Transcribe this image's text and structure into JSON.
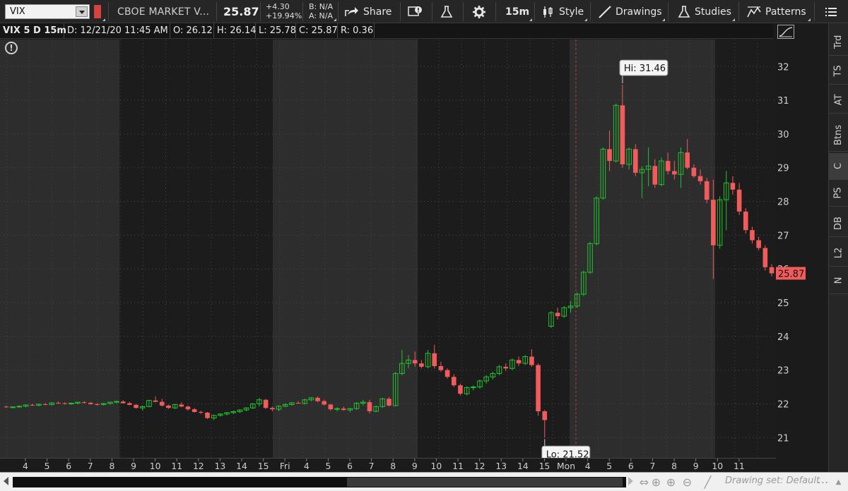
{
  "toolbar": {
    "symbol": "VIX",
    "description": "CBOE MARKET V...",
    "last_price": "25.87",
    "net_change": "+4.30",
    "pct_change": "+19.94%",
    "bid": "B: N/A",
    "ask": "A: N/A",
    "share_label": "Share",
    "timeframe": "15m",
    "style_label": "Style",
    "drawings_label": "Drawings",
    "studies_label": "Studies",
    "patterns_label": "Patterns"
  },
  "infobar": {
    "title": "VIX 5 D 15m",
    "date": "D: 12/21/20 11:45 AM",
    "open": "O: 26.12",
    "high": "H: 26.14",
    "low": "L: 25.78",
    "close": "C: 25.87",
    "range": "R: 0.36"
  },
  "side_tabs": [
    "Trd",
    "TS",
    "AT",
    "Btns",
    "C",
    "PS",
    "DB",
    "L2",
    "N"
  ],
  "active_side_tab": "C",
  "bottom": {
    "drawing_set": "Drawing set: Default"
  },
  "chart_data": {
    "type": "candlestick",
    "symbol": "VIX",
    "ylim": [
      20.4,
      32.8
    ],
    "y_ticks": [
      21,
      22,
      23,
      24,
      25,
      26,
      27,
      28,
      29,
      30,
      31,
      32
    ],
    "x_tick_labels": [
      "4",
      "5",
      "6",
      "7",
      "8",
      "9",
      "10",
      "11",
      "12",
      "13",
      "14",
      "15",
      "Fri",
      "4",
      "5",
      "6",
      "7",
      "8",
      "9",
      "10",
      "11",
      "12",
      "13",
      "14",
      "15",
      "Mon",
      "4",
      "5",
      "6",
      "7",
      "8",
      "9",
      "10",
      "11"
    ],
    "last_price_label": "25.87",
    "hi_label": "Hi: 31.46",
    "lo_label": "Lo: 21.52",
    "colors": {
      "up": "#22c22e",
      "down": "#f25b5b",
      "session_light": "#2d2d2d",
      "session_dark": "#1c1c1c"
    },
    "candles": [
      [
        21.92,
        21.95,
        21.88,
        21.9
      ],
      [
        21.9,
        21.93,
        21.87,
        21.91
      ],
      [
        21.91,
        21.95,
        21.88,
        21.93
      ],
      [
        21.93,
        21.98,
        21.9,
        21.97
      ],
      [
        21.97,
        22.0,
        21.94,
        21.96
      ],
      [
        21.96,
        22.01,
        21.93,
        21.99
      ],
      [
        21.99,
        22.03,
        21.96,
        21.98
      ],
      [
        21.98,
        22.05,
        21.95,
        22.03
      ],
      [
        22.03,
        22.07,
        22.0,
        22.02
      ],
      [
        22.02,
        22.05,
        21.98,
        22.0
      ],
      [
        22.0,
        22.04,
        21.97,
        22.02
      ],
      [
        22.02,
        22.06,
        21.99,
        22.05
      ],
      [
        22.05,
        22.08,
        22.01,
        22.03
      ],
      [
        22.03,
        22.06,
        21.98,
        21.99
      ],
      [
        21.99,
        22.02,
        21.95,
        21.98
      ],
      [
        21.98,
        22.03,
        21.95,
        22.01
      ],
      [
        22.01,
        22.06,
        21.98,
        22.05
      ],
      [
        22.05,
        22.1,
        22.02,
        22.07
      ],
      [
        22.07,
        22.11,
        22.01,
        22.02
      ],
      [
        22.02,
        22.06,
        21.96,
        21.97
      ],
      [
        21.97,
        22.0,
        21.86,
        21.88
      ],
      [
        21.88,
        21.95,
        21.8,
        21.92
      ],
      [
        21.92,
        22.12,
        21.9,
        22.1
      ],
      [
        22.1,
        22.22,
        22.05,
        22.06
      ],
      [
        22.06,
        22.15,
        21.92,
        21.95
      ],
      [
        21.95,
        21.98,
        21.85,
        21.88
      ],
      [
        21.88,
        22.0,
        21.85,
        21.98
      ],
      [
        21.98,
        22.05,
        21.9,
        21.92
      ],
      [
        21.92,
        21.95,
        21.8,
        21.84
      ],
      [
        21.84,
        21.88,
        21.74,
        21.76
      ],
      [
        21.76,
        21.8,
        21.7,
        21.74
      ],
      [
        21.74,
        21.76,
        21.55,
        21.58
      ],
      [
        21.58,
        21.68,
        21.52,
        21.66
      ],
      [
        21.66,
        21.72,
        21.62,
        21.7
      ],
      [
        21.7,
        21.76,
        21.66,
        21.74
      ],
      [
        21.74,
        21.8,
        21.7,
        21.77
      ],
      [
        21.77,
        21.84,
        21.73,
        21.82
      ],
      [
        21.82,
        21.9,
        21.78,
        21.88
      ],
      [
        21.88,
        22.02,
        21.85,
        22.0
      ],
      [
        22.0,
        22.18,
        21.92,
        22.12
      ],
      [
        22.12,
        22.15,
        21.85,
        21.88
      ],
      [
        21.88,
        21.92,
        21.78,
        21.84
      ],
      [
        21.84,
        21.96,
        21.78,
        21.93
      ],
      [
        21.93,
        22.02,
        21.9,
        21.98
      ],
      [
        21.98,
        22.05,
        21.95,
        22.03
      ],
      [
        22.03,
        22.08,
        22.0,
        22.01
      ],
      [
        22.01,
        22.15,
        21.98,
        22.12
      ],
      [
        22.12,
        22.2,
        22.08,
        22.18
      ],
      [
        22.18,
        22.22,
        22.05,
        22.08
      ],
      [
        22.08,
        22.12,
        21.95,
        21.98
      ],
      [
        21.98,
        22.0,
        21.8,
        21.84
      ],
      [
        21.84,
        21.9,
        21.78,
        21.86
      ],
      [
        21.86,
        21.92,
        21.8,
        21.82
      ],
      [
        21.82,
        21.88,
        21.75,
        21.86
      ],
      [
        21.86,
        22.05,
        21.82,
        22.02
      ],
      [
        22.02,
        22.12,
        21.95,
        22.05
      ],
      [
        22.05,
        22.12,
        21.72,
        21.78
      ],
      [
        21.78,
        21.95,
        21.75,
        21.92
      ],
      [
        21.92,
        22.18,
        21.88,
        22.15
      ],
      [
        22.15,
        22.2,
        21.92,
        21.95
      ],
      [
        21.95,
        22.95,
        21.92,
        22.9
      ],
      [
        22.9,
        23.6,
        22.85,
        23.2
      ],
      [
        23.2,
        23.45,
        23.05,
        23.3
      ],
      [
        23.3,
        23.55,
        23.1,
        23.2
      ],
      [
        23.2,
        23.3,
        23.05,
        23.1
      ],
      [
        23.1,
        23.6,
        23.05,
        23.5
      ],
      [
        23.5,
        23.75,
        23.05,
        23.12
      ],
      [
        23.12,
        23.25,
        22.95,
        23.0
      ],
      [
        23.0,
        23.05,
        22.75,
        22.8
      ],
      [
        22.8,
        22.88,
        22.5,
        22.55
      ],
      [
        22.55,
        22.6,
        22.25,
        22.3
      ],
      [
        22.3,
        22.52,
        22.25,
        22.48
      ],
      [
        22.48,
        22.55,
        22.4,
        22.5
      ],
      [
        22.5,
        22.72,
        22.45,
        22.68
      ],
      [
        22.68,
        22.85,
        22.6,
        22.8
      ],
      [
        22.8,
        22.95,
        22.72,
        22.9
      ],
      [
        22.9,
        23.15,
        22.85,
        23.1
      ],
      [
        23.1,
        23.2,
        22.98,
        23.05
      ],
      [
        23.05,
        23.35,
        23.0,
        23.3
      ],
      [
        23.3,
        23.4,
        23.12,
        23.2
      ],
      [
        23.2,
        23.45,
        23.15,
        23.4
      ],
      [
        23.4,
        23.62,
        23.1,
        23.15
      ],
      [
        23.15,
        23.2,
        21.65,
        21.78
      ],
      [
        21.78,
        21.82,
        21.0,
        21.52
      ],
      [
        24.3,
        24.75,
        24.25,
        24.7
      ],
      [
        24.7,
        24.85,
        24.5,
        24.6
      ],
      [
        24.6,
        24.9,
        24.55,
        24.85
      ],
      [
        24.85,
        25.05,
        24.7,
        24.9
      ],
      [
        24.9,
        25.3,
        24.85,
        25.25
      ],
      [
        25.25,
        25.95,
        25.2,
        25.9
      ],
      [
        25.9,
        26.8,
        25.85,
        26.75
      ],
      [
        26.75,
        28.15,
        26.7,
        28.1
      ],
      [
        28.1,
        29.6,
        28.05,
        29.55
      ],
      [
        29.55,
        30.1,
        28.9,
        29.2
      ],
      [
        29.2,
        30.9,
        29.15,
        30.85
      ],
      [
        30.85,
        31.46,
        29.0,
        29.1
      ],
      [
        29.1,
        29.6,
        28.95,
        29.55
      ],
      [
        29.55,
        29.7,
        28.75,
        28.85
      ],
      [
        28.85,
        29.05,
        28.1,
        28.95
      ],
      [
        28.95,
        29.6,
        28.45,
        29.05
      ],
      [
        29.05,
        29.25,
        28.4,
        28.5
      ],
      [
        28.5,
        29.3,
        28.45,
        29.2
      ],
      [
        29.2,
        29.45,
        28.8,
        28.9
      ],
      [
        28.9,
        29.2,
        28.65,
        28.8
      ],
      [
        28.8,
        29.6,
        28.4,
        29.45
      ],
      [
        29.45,
        29.85,
        28.95,
        29.0
      ],
      [
        29.0,
        29.1,
        28.7,
        28.75
      ],
      [
        28.75,
        28.95,
        28.5,
        28.6
      ],
      [
        28.6,
        28.7,
        27.95,
        28.05
      ],
      [
        28.05,
        28.65,
        25.7,
        26.7
      ],
      [
        26.7,
        28.15,
        26.6,
        28.05
      ],
      [
        28.05,
        28.9,
        27.15,
        28.55
      ],
      [
        28.55,
        28.75,
        28.2,
        28.35
      ],
      [
        28.35,
        28.55,
        27.6,
        27.7
      ],
      [
        27.7,
        27.8,
        27.05,
        27.15
      ],
      [
        27.15,
        27.25,
        26.75,
        26.85
      ],
      [
        26.85,
        26.95,
        26.55,
        26.62
      ],
      [
        26.62,
        26.7,
        25.95,
        26.05
      ],
      [
        26.05,
        26.14,
        25.78,
        25.87
      ]
    ]
  }
}
